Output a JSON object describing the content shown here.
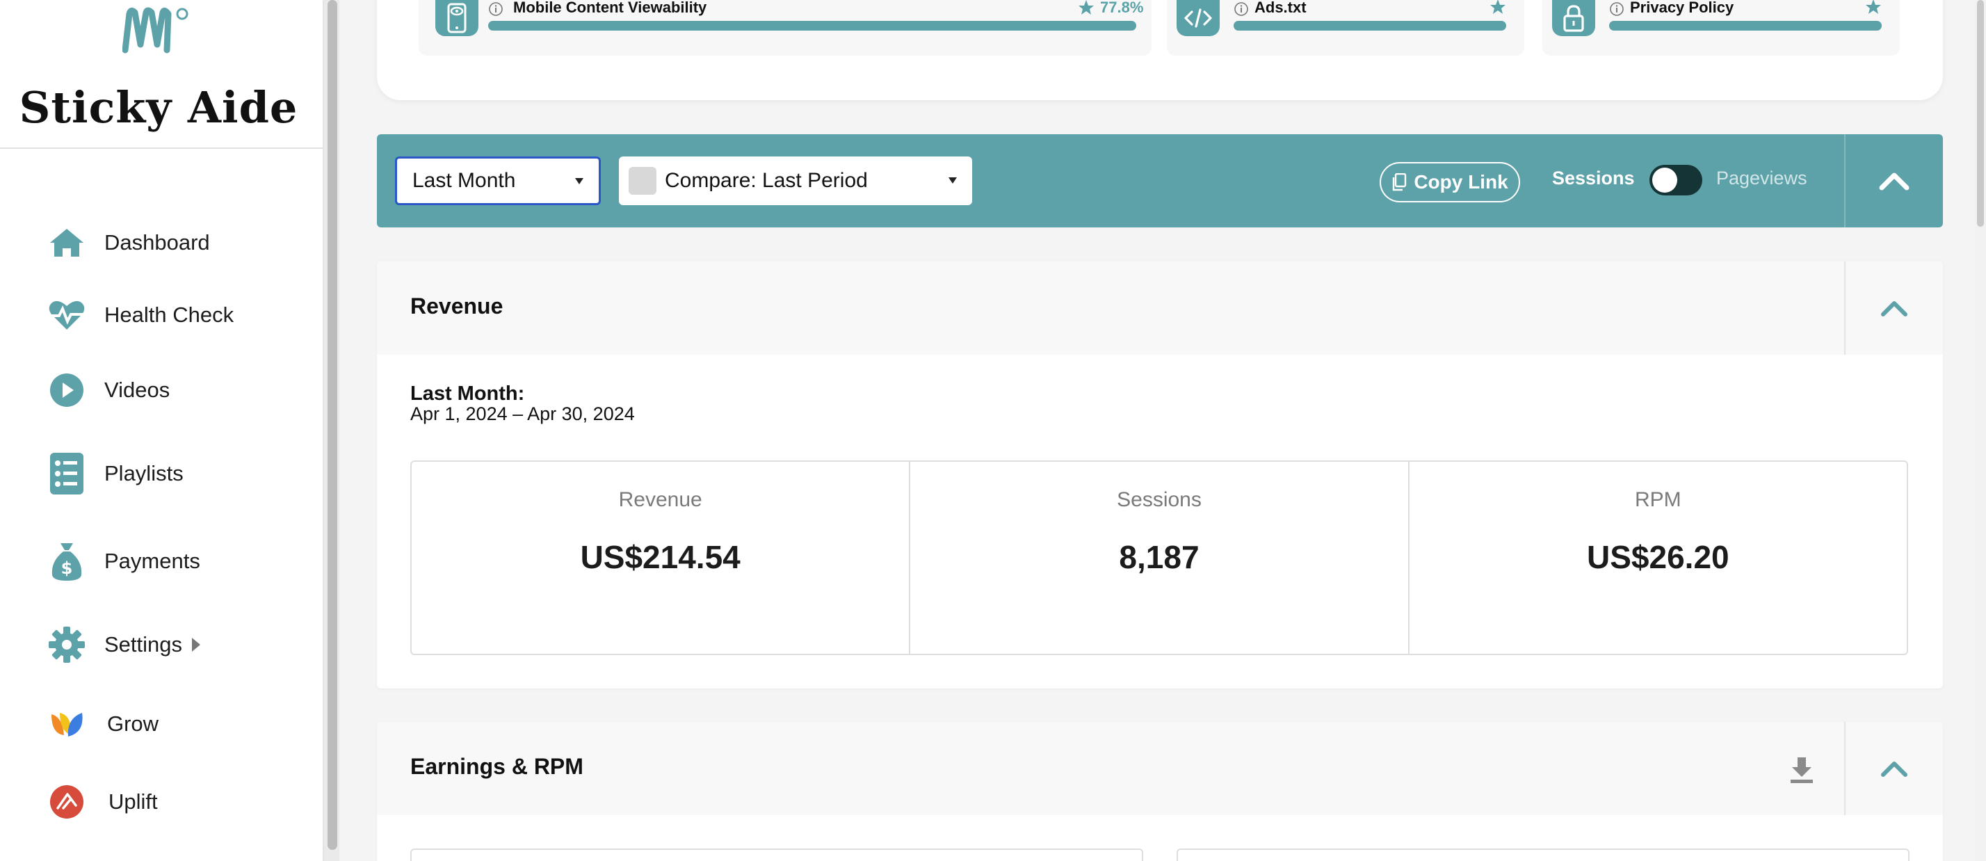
{
  "brand": {
    "name": "Sticky Aide"
  },
  "sidebar": {
    "items": [
      {
        "label": "Dashboard",
        "icon": "home-icon"
      },
      {
        "label": "Health Check",
        "icon": "heartbeat-icon"
      },
      {
        "label": "Videos",
        "icon": "play-icon"
      },
      {
        "label": "Playlists",
        "icon": "list-icon"
      },
      {
        "label": "Payments",
        "icon": "money-bag-icon"
      },
      {
        "label": "Settings",
        "icon": "gear-icon"
      },
      {
        "label": "Grow",
        "icon": "grow-icon"
      },
      {
        "label": "Uplift",
        "icon": "uplift-icon"
      }
    ]
  },
  "health_cards": [
    {
      "title": "Mobile Content Viewability",
      "icon": "mobile-eye-icon",
      "percent": "77.8%"
    },
    {
      "title": "Ads.txt",
      "icon": "code-icon",
      "percent": ""
    },
    {
      "title": "Privacy Policy",
      "icon": "lock-icon",
      "percent": ""
    }
  ],
  "toolbar": {
    "date_range": "Last Month",
    "compare": "Compare: Last Period",
    "copy_link": "Copy Link",
    "toggle_left": "Sessions",
    "toggle_right": "Pageviews"
  },
  "revenue": {
    "title": "Revenue",
    "period_label": "Last Month:",
    "period_range": "Apr 1, 2024 – Apr 30, 2024",
    "stats": [
      {
        "label": "Revenue",
        "value": "US$214.54"
      },
      {
        "label": "Sessions",
        "value": "8,187"
      },
      {
        "label": "RPM",
        "value": "US$26.20"
      }
    ]
  },
  "earnings": {
    "title": "Earnings & RPM"
  },
  "colors": {
    "accent": "#5ea2a9",
    "focus": "#2b56c8",
    "uplift": "#d64b3c"
  }
}
